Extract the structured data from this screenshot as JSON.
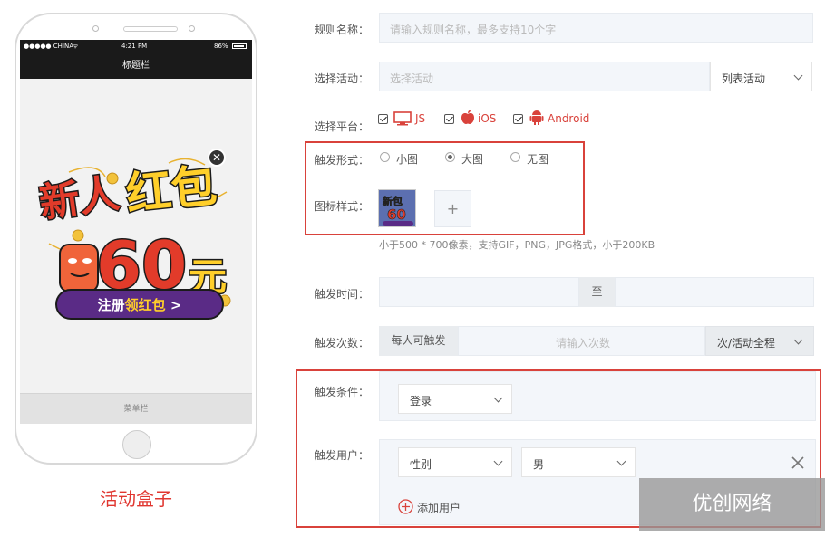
{
  "phone": {
    "carrier": "●●●●● CHINA",
    "time": "4:21 PM",
    "battery": "86%",
    "title_bar": "标题栏",
    "menu_bar": "菜单栏",
    "caption": "活动盒子"
  },
  "form": {
    "rule_name": {
      "label": "规则名称：",
      "placeholder": "请输入规则名称，最多支持10个字"
    },
    "activity": {
      "label": "选择活动：",
      "placeholder": "选择活动",
      "select_value": "列表活动"
    },
    "platform": {
      "label": "选择平台：",
      "options": [
        {
          "name": "JS",
          "checked": true
        },
        {
          "name": "iOS",
          "checked": true
        },
        {
          "name": "Android",
          "checked": true
        }
      ]
    },
    "trigger_form": {
      "label": "触发形式：",
      "options": [
        {
          "name": "小图",
          "selected": false
        },
        {
          "name": "大图",
          "selected": true
        },
        {
          "name": "无图",
          "selected": false
        }
      ]
    },
    "icon_style": {
      "label": "图标样式：",
      "add": "+",
      "hint": "小于500 * 700像素，支持GIF，PNG，JPG格式，小于200KB"
    },
    "trigger_time": {
      "label": "触发时间：",
      "separator": "至"
    },
    "trigger_count": {
      "label": "触发次数：",
      "prefix": "每人可触发",
      "placeholder": "请输入次数",
      "suffix_select": "次/活动全程"
    },
    "trigger_condition": {
      "label": "触发条件：",
      "value": "登录"
    },
    "trigger_user": {
      "label": "触发用户：",
      "field_select": "性别",
      "value_select": "男",
      "add_label": "添加用户"
    }
  },
  "watermark": "优创网络",
  "colors": {
    "accent_red": "#d9423b",
    "caption_red": "#e0362f",
    "field_bg": "#f3f6fa"
  }
}
